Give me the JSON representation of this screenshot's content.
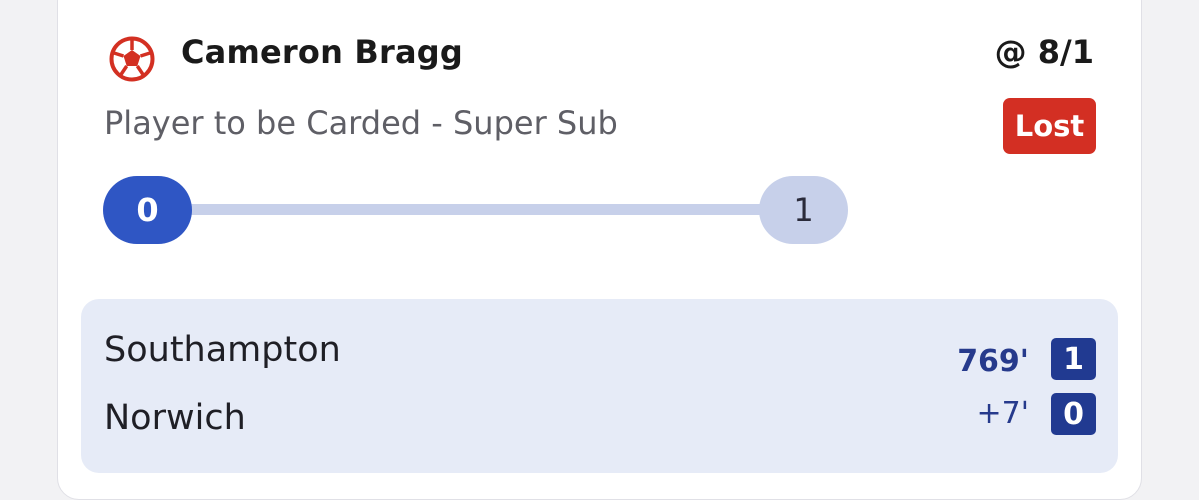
{
  "bet": {
    "player_name": "Cameron Bragg",
    "odds": "@ 8/1",
    "market": "Player to be Carded - Super Sub",
    "status": "Lost",
    "status_color": "#d32f23",
    "icon": "football-icon"
  },
  "progress": {
    "current": "0",
    "target": "1",
    "fraction": 0
  },
  "match": {
    "home_team": "Southampton",
    "away_team": "Norwich",
    "clock": "769'",
    "added_time": "+7'",
    "home_score": "1",
    "away_score": "0"
  },
  "colors": {
    "accent": "#2f56c4",
    "score_box": "#213a91",
    "panel": "#e6ebf7"
  }
}
